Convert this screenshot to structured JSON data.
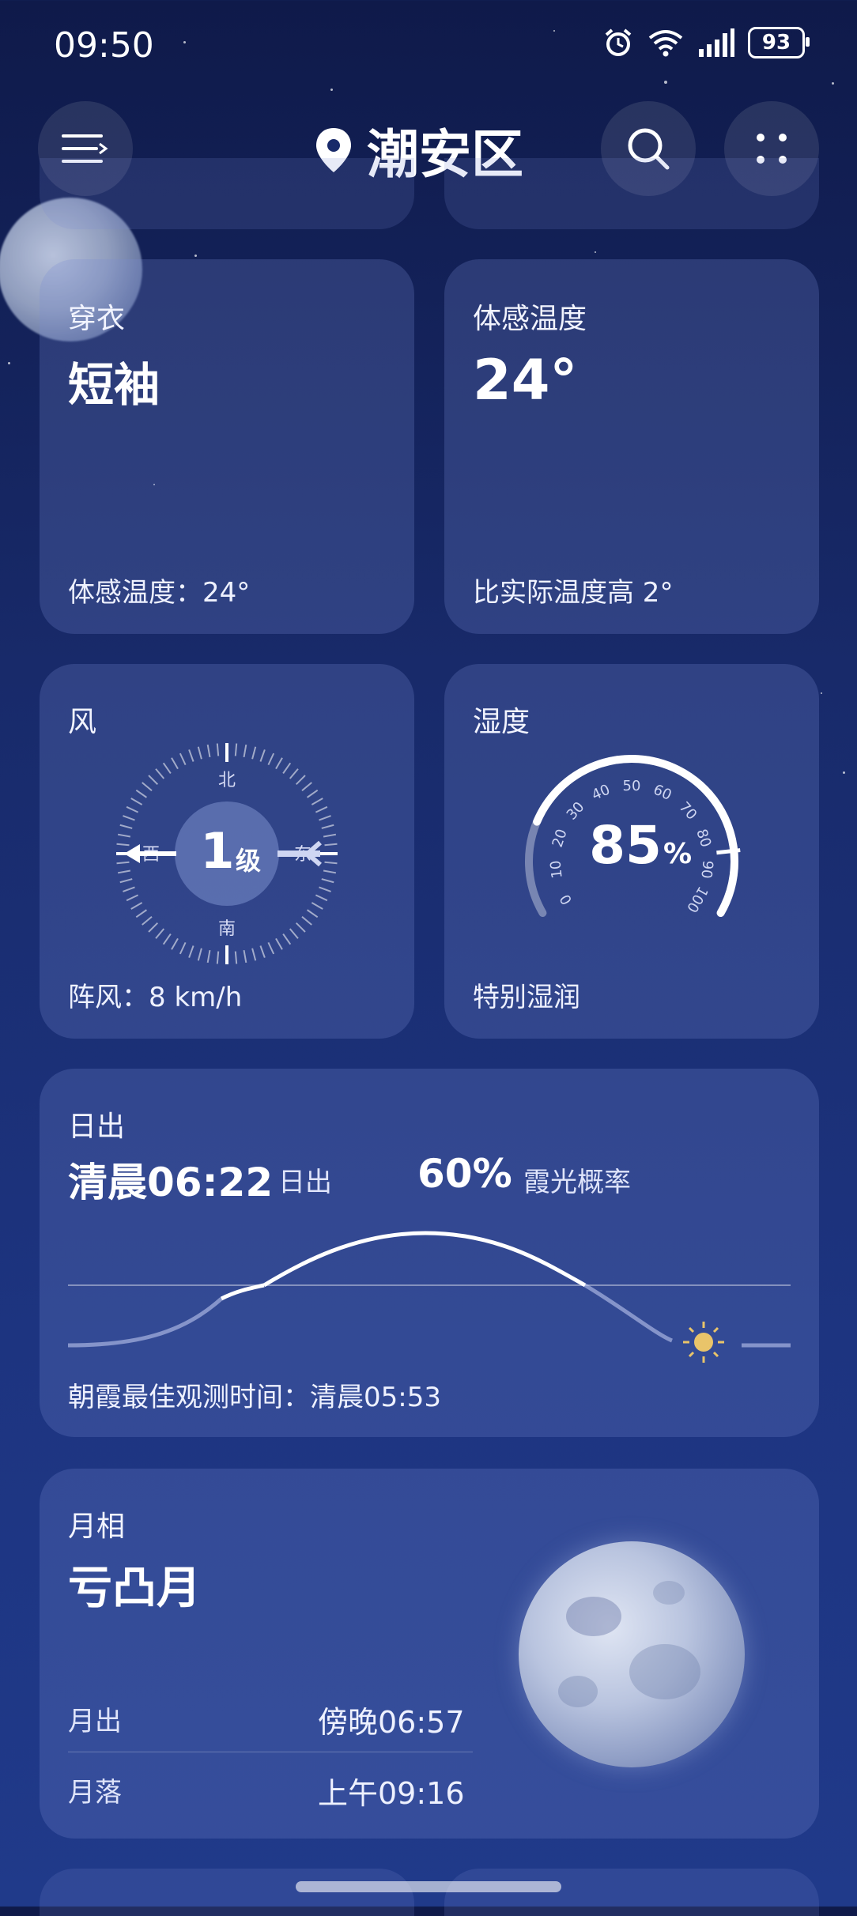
{
  "status": {
    "time": "09:50",
    "battery": "93"
  },
  "header": {
    "location": "潮安区"
  },
  "clothing": {
    "label": "穿衣",
    "value": "短袖",
    "feels": "体感温度：24°"
  },
  "feels_like": {
    "label": "体感温度",
    "value": "24°",
    "compare": "比实际温度高 2°"
  },
  "wind": {
    "label": "风",
    "level": "1",
    "level_unit": "级",
    "north": "北",
    "south": "南",
    "west": "西",
    "east": "东",
    "gust": "阵风：8 km/h"
  },
  "humidity": {
    "label": "湿度",
    "value": "85",
    "unit": "%",
    "fraction": 0.85,
    "desc": "特别湿润",
    "ticks": [
      "0",
      "10",
      "20",
      "30",
      "40",
      "50",
      "60",
      "70",
      "80",
      "90",
      "100"
    ]
  },
  "sunrise": {
    "label": "日出",
    "time": "清晨06:22",
    "time_suffix": "日出",
    "glow_prob": "60%",
    "glow_label": "霞光概率",
    "best_time": "朝霞最佳观测时间：清晨05:53"
  },
  "moon": {
    "label": "月相",
    "phase": "亏凸月",
    "rise_label": "月出",
    "rise_time": "傍晚06:57",
    "set_label": "月落",
    "set_time": "上午09:16"
  },
  "colors": {
    "accent_sun": "#e9c46a",
    "card": "#3a4a8c"
  }
}
